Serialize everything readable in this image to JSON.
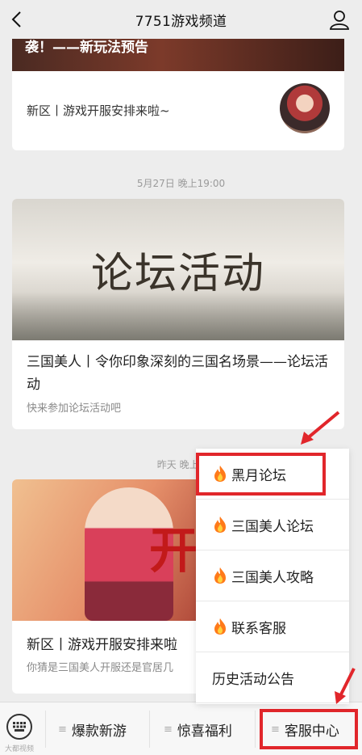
{
  "header": {
    "title": "7751游戏频道"
  },
  "feed": {
    "card1": {
      "banner_text": "袭！——新玩法预告",
      "title": "新区丨游戏开服安排来啦~"
    },
    "time1": "5月27日 晚上19:00",
    "card2": {
      "banner_text": "论坛活动",
      "title": "三国美人丨令你印象深刻的三国名场景——论坛活动",
      "subtitle": "快来参加论坛活动吧"
    },
    "time2": "昨天 晚上9",
    "card3": {
      "banner_text": "开服",
      "title": "新区丨游戏开服安排来啦",
      "subtitle": "你猜是三国美人开服还是官居几"
    }
  },
  "popup_menu": {
    "items": [
      {
        "label": "黑月论坛",
        "icon": "fire-icon"
      },
      {
        "label": "三国美人论坛",
        "icon": "fire-icon"
      },
      {
        "label": "三国美人攻略",
        "icon": "fire-icon"
      },
      {
        "label": "联系客服",
        "icon": "fire-icon"
      },
      {
        "label": "历史活动公告",
        "icon": ""
      }
    ]
  },
  "bottom_menu": {
    "tabs": [
      {
        "label": "爆款新游"
      },
      {
        "label": "惊喜福利"
      },
      {
        "label": "客服中心"
      }
    ],
    "watermark": "大都视频"
  },
  "colors": {
    "highlight": "#e1262b",
    "background": "#ededed"
  }
}
